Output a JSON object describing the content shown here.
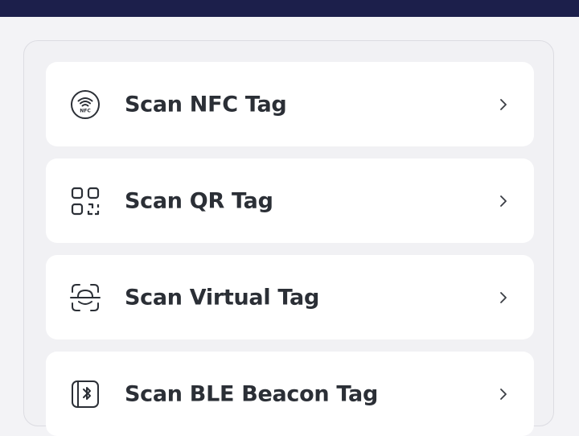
{
  "colors": {
    "header": "#1c1f4b",
    "background": "#f3f3f6",
    "card": "#ffffff",
    "text": "#2b2f36",
    "icon": "#2b2f36"
  },
  "scan_menu": {
    "items": [
      {
        "label": "Scan NFC Tag",
        "icon": "nfc-icon",
        "icon_text": "NFC"
      },
      {
        "label": "Scan QR Tag",
        "icon": "qr-code-icon"
      },
      {
        "label": "Scan Virtual Tag",
        "icon": "face-scan-icon"
      },
      {
        "label": "Scan BLE Beacon Tag",
        "icon": "bluetooth-beacon-icon"
      }
    ]
  }
}
